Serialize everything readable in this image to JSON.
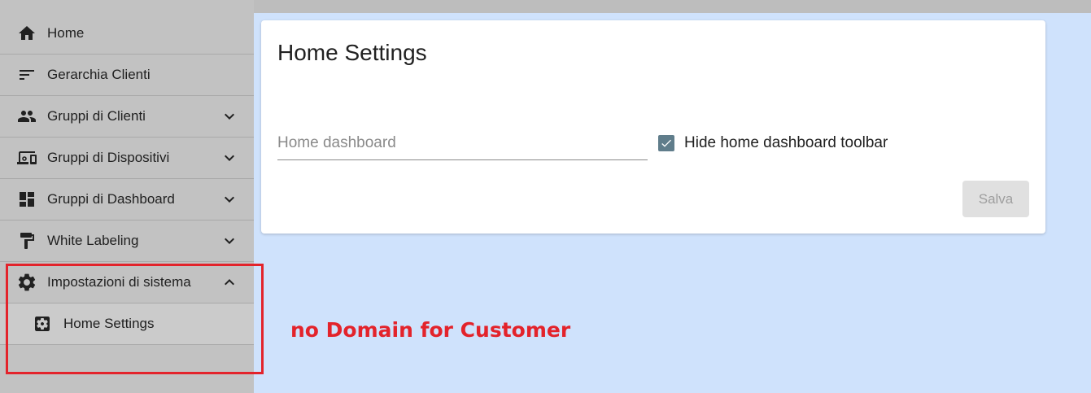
{
  "sidebar": {
    "items": [
      {
        "label": "Home",
        "icon": "home-icon"
      },
      {
        "label": "Gerarchia Clienti",
        "icon": "sort-icon"
      },
      {
        "label": "Gruppi di Clienti",
        "icon": "people-icon",
        "expand": "collapsed"
      },
      {
        "label": "Gruppi di Dispositivi",
        "icon": "devices-icon",
        "expand": "collapsed"
      },
      {
        "label": "Gruppi di Dashboard",
        "icon": "dashboard-icon",
        "expand": "collapsed"
      },
      {
        "label": "White Labeling",
        "icon": "paint-roller-icon",
        "expand": "collapsed"
      },
      {
        "label": "Impostazioni di sistema",
        "icon": "gear-icon",
        "expand": "expanded"
      }
    ],
    "sub_items": [
      {
        "label": "Home Settings",
        "icon": "settings-applications-icon"
      }
    ]
  },
  "main": {
    "card": {
      "title": "Home Settings",
      "dashboard_placeholder": "Home dashboard",
      "dashboard_value": "",
      "hide_toolbar_label": "Hide home dashboard toolbar",
      "hide_toolbar_checked": true,
      "save_label": "Salva"
    }
  },
  "annotation": {
    "text": "no Domain for Customer",
    "color": "#e3232b"
  },
  "colors": {
    "sidebar_bg": "#c2c2c2",
    "content_bg": "#cfe2fc",
    "checkbox": "#607d8b",
    "highlight": "#e3232b"
  }
}
